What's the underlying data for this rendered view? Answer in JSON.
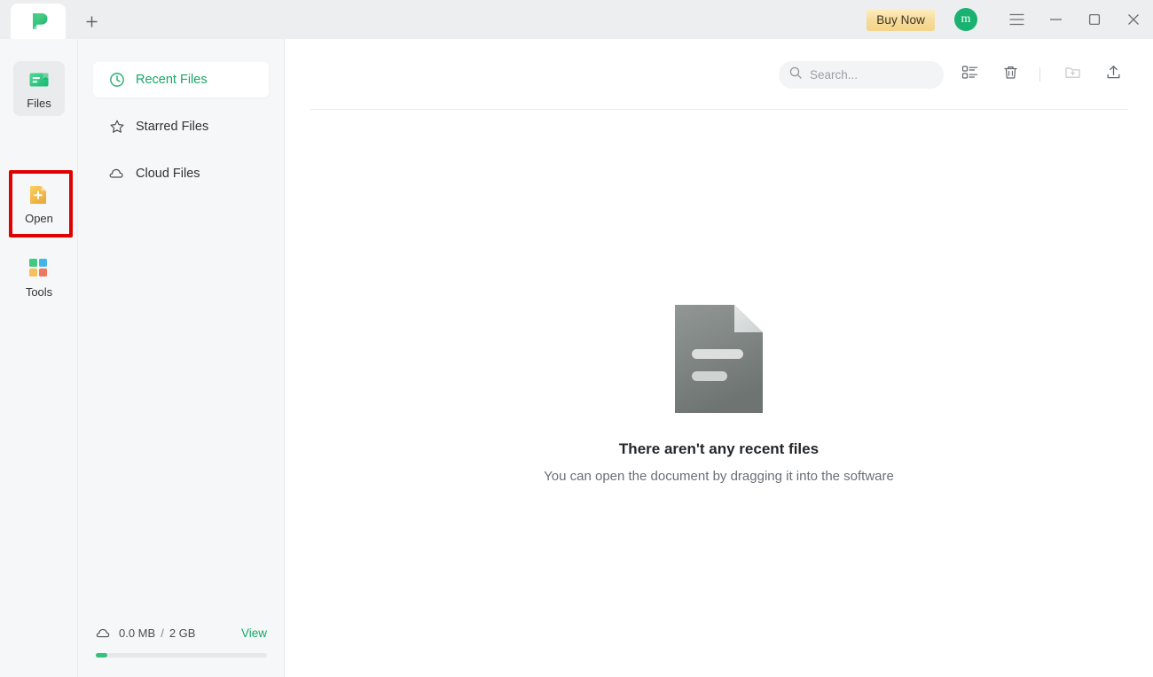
{
  "titlebar": {
    "tab_logo_icon": "app-logo-icon",
    "new_tab_icon": "plus-icon",
    "buy_now_label": "Buy Now",
    "avatar_initial": "m",
    "menu_icon": "hamburger-menu-icon",
    "minimize_icon": "minimize-icon",
    "maximize_icon": "maximize-icon",
    "close_icon": "close-icon"
  },
  "rail": {
    "items": [
      {
        "label": "Files",
        "icon": "files-icon",
        "active": true
      },
      {
        "label": "Open",
        "icon": "open-document-plus-icon",
        "active": false
      },
      {
        "label": "Tools",
        "icon": "tools-grid-icon",
        "active": false
      }
    ],
    "highlight_color": "#e00000"
  },
  "nav": {
    "items": [
      {
        "label": "Recent Files",
        "icon": "clock-icon",
        "active": true
      },
      {
        "label": "Starred Files",
        "icon": "star-icon",
        "active": false
      },
      {
        "label": "Cloud Files",
        "icon": "cloud-icon",
        "active": false
      }
    ],
    "accent_color": "#16a668"
  },
  "storage": {
    "cloud_icon": "cloud-icon",
    "used": "0.0 MB",
    "separator": "/",
    "total": "2 GB",
    "view_label": "View",
    "fill_color": "#35c07d"
  },
  "toolbar": {
    "search_placeholder": "Search...",
    "search_value": "",
    "search_icon": "search-icon",
    "list_view_icon": "list-view-icon",
    "trash_icon": "trash-icon",
    "new_folder_icon": "new-folder-icon",
    "upload_icon": "upload-icon"
  },
  "empty_state": {
    "document_icon": "document-placeholder-icon",
    "title": "There aren't any recent files",
    "subtitle": "You can open the document by dragging it into the software"
  }
}
